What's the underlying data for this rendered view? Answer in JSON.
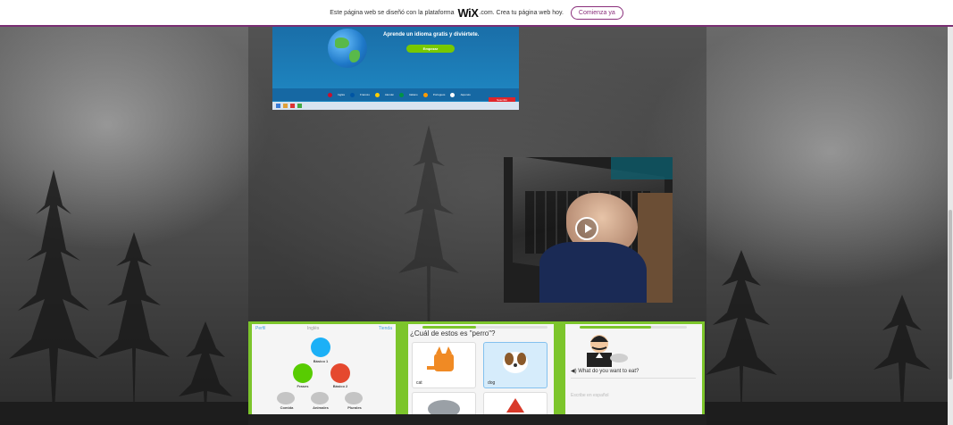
{
  "wix_banner": {
    "text_before": "Este página web se diseñó con la plataforma",
    "logo": "WiX",
    "text_after": ".com. Crea tu página web hoy.",
    "cta_label": "Comienza ya"
  },
  "duolingo_screenshot": {
    "tagline": "Aprende un idioma gratis y diviértete.",
    "start_label": "Empezar",
    "languages": [
      {
        "name": "Inglés",
        "color": "#c8102e"
      },
      {
        "name": "Francés",
        "color": "#0055a4"
      },
      {
        "name": "Alemán",
        "color": "#ffce00"
      },
      {
        "name": "Italiano",
        "color": "#009246"
      },
      {
        "name": "Portugués",
        "color": "#ff9b00"
      },
      {
        "name": "Japonés",
        "color": "#ffffff"
      }
    ],
    "live_badge": "Suscríbir"
  },
  "video": {
    "play_icon": "play-icon"
  },
  "collage": {
    "panel1": {
      "perfil": "Perfil",
      "language": "Inglés",
      "tienda": "Tienda",
      "skills": [
        {
          "label": "Básico 1",
          "color": "#1cb0f6"
        },
        {
          "label": "Frases",
          "color": "#58cc02"
        },
        {
          "label": "Básico 2",
          "color": "#e5492f"
        },
        {
          "label": "Comida",
          "color": "#c4c4c4"
        },
        {
          "label": "Animales",
          "color": "#c4c4c4"
        },
        {
          "label": "Plurales",
          "color": "#c4c4c4"
        }
      ]
    },
    "panel2": {
      "question": "¿Cuál de estos es \"perro\"?",
      "cards": [
        {
          "label": "cat"
        },
        {
          "label": "dog"
        }
      ]
    },
    "panel3": {
      "question": "What do you want to eat?",
      "placeholder": "Escribe en español"
    }
  },
  "colors": {
    "wix_accent": "#8a2f7b",
    "duolingo_green": "#7cc52b",
    "duolingo_blue": "#1cb0f6"
  }
}
